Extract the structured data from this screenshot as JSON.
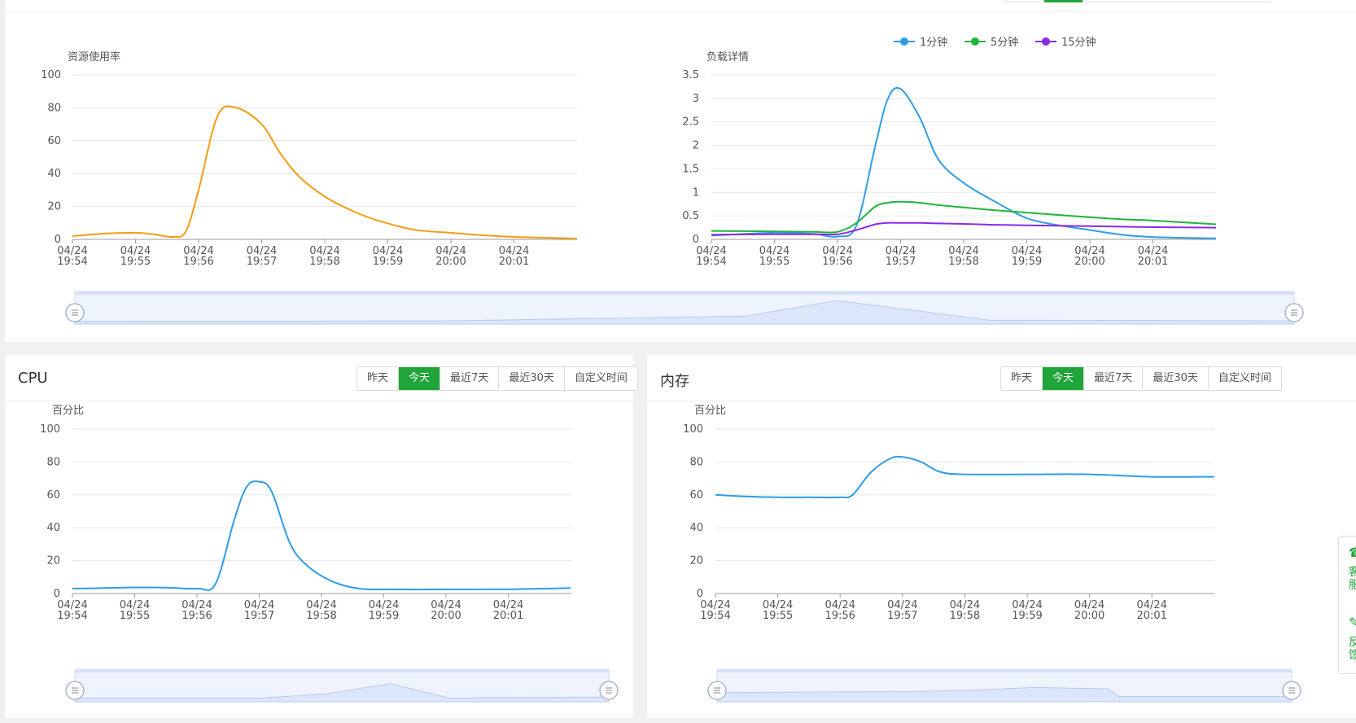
{
  "time_buttons": [
    "昨天",
    "今天",
    "最近7天",
    "最近30天",
    "自定义时间"
  ],
  "time_active_index": 1,
  "cpu_panel": {
    "title": "CPU"
  },
  "mem_panel": {
    "title": "内存"
  },
  "side_float": {
    "service_label": "客服",
    "feedback_label": "反馈"
  },
  "colors": {
    "accent": "#20a53a",
    "orange": "#f39c12",
    "blue": "#2f9ce9",
    "green": "#20b53a",
    "purple": "#8a2be2",
    "zoom_fill": "#dbe6fb"
  },
  "chart_data": [
    {
      "type": "line",
      "ylabel": "资源使用率",
      "ylim": [
        0,
        100
      ],
      "yticks": [
        0,
        20,
        40,
        60,
        80,
        100
      ],
      "xtick_labels": [
        [
          "04/24",
          "19:54"
        ],
        [
          "04/24",
          "19:55"
        ],
        [
          "04/24",
          "19:56"
        ],
        [
          "04/24",
          "19:57"
        ],
        [
          "04/24",
          "19:58"
        ],
        [
          "04/24",
          "19:59"
        ],
        [
          "04/24",
          "20:00"
        ],
        [
          "04/24",
          "20:01"
        ]
      ],
      "x": [
        0,
        0.5,
        1,
        1.3,
        1.6,
        1.8,
        2,
        2.3,
        2.6,
        3,
        3.3,
        3.6,
        4,
        4.4,
        4.8,
        5.4,
        6,
        6.5,
        7,
        7.5,
        8
      ],
      "series": [
        {
          "values": [
            2,
            3.5,
            4,
            3,
            1.5,
            5,
            30,
            75,
            80,
            70,
            52,
            38,
            26,
            18,
            12,
            6,
            4,
            2.5,
            1.5,
            1,
            0.5
          ],
          "color": "#f39c12"
        }
      ]
    },
    {
      "type": "line",
      "ylabel": "负载详情",
      "ylim": [
        0,
        3.5
      ],
      "yticks": [
        0,
        0.5,
        1,
        1.5,
        2,
        2.5,
        3,
        3.5
      ],
      "xtick_labels": [
        [
          "04/24",
          "19:54"
        ],
        [
          "04/24",
          "19:55"
        ],
        [
          "04/24",
          "19:56"
        ],
        [
          "04/24",
          "19:57"
        ],
        [
          "04/24",
          "19:58"
        ],
        [
          "04/24",
          "19:59"
        ],
        [
          "04/24",
          "20:00"
        ],
        [
          "04/24",
          "20:01"
        ]
      ],
      "x": [
        0,
        1,
        1.6,
        2,
        2.3,
        2.6,
        2.8,
        3,
        3.3,
        3.6,
        4,
        4.5,
        5,
        5.5,
        6,
        6.5,
        7,
        8
      ],
      "series": [
        {
          "name": "1分钟",
          "values": [
            0.08,
            0.14,
            0.12,
            0.06,
            0.3,
            2,
            3.0,
            3.2,
            2.6,
            1.7,
            1.2,
            0.8,
            0.45,
            0.3,
            0.2,
            0.1,
            0.05,
            0.02
          ],
          "color": "#2f9ce9"
        },
        {
          "name": "5分钟",
          "values": [
            0.18,
            0.17,
            0.16,
            0.16,
            0.35,
            0.7,
            0.78,
            0.8,
            0.78,
            0.73,
            0.68,
            0.62,
            0.57,
            0.52,
            0.47,
            0.43,
            0.4,
            0.32
          ],
          "color": "#20b53a"
        },
        {
          "name": "15分钟",
          "values": [
            0.1,
            0.11,
            0.11,
            0.11,
            0.2,
            0.32,
            0.35,
            0.35,
            0.35,
            0.34,
            0.33,
            0.31,
            0.3,
            0.29,
            0.28,
            0.27,
            0.26,
            0.25
          ],
          "color": "#8a2be2"
        }
      ],
      "legend": "top"
    },
    {
      "type": "line",
      "ylabel": "百分比",
      "ylim": [
        0,
        100
      ],
      "yticks": [
        0,
        20,
        40,
        60,
        80,
        100
      ],
      "xtick_labels": [
        [
          "04/24",
          "19:54"
        ],
        [
          "04/24",
          "19:55"
        ],
        [
          "04/24",
          "19:56"
        ],
        [
          "04/24",
          "19:57"
        ],
        [
          "04/24",
          "19:58"
        ],
        [
          "04/24",
          "19:59"
        ],
        [
          "04/24",
          "20:00"
        ],
        [
          "04/24",
          "20:01"
        ]
      ],
      "x": [
        0,
        0.5,
        1,
        1.5,
        2,
        2.3,
        2.6,
        2.8,
        3,
        3.2,
        3.5,
        3.8,
        4.2,
        4.6,
        5,
        6,
        7,
        8
      ],
      "series": [
        {
          "values": [
            3,
            3.3,
            3.7,
            3.6,
            3,
            6,
            45,
            65,
            68,
            62,
            30,
            16,
            7,
            3,
            2.5,
            2.5,
            2.6,
            3.3
          ],
          "color": "#2f9ce9"
        }
      ]
    },
    {
      "type": "line",
      "ylabel": "百分比",
      "ylim": [
        0,
        100
      ],
      "yticks": [
        0,
        20,
        40,
        60,
        80,
        100
      ],
      "xtick_labels": [
        [
          "04/24",
          "19:54"
        ],
        [
          "04/24",
          "19:55"
        ],
        [
          "04/24",
          "19:56"
        ],
        [
          "04/24",
          "19:57"
        ],
        [
          "04/24",
          "19:58"
        ],
        [
          "04/24",
          "19:59"
        ],
        [
          "04/24",
          "20:00"
        ],
        [
          "04/24",
          "20:01"
        ]
      ],
      "x": [
        0,
        0.5,
        1,
        1.5,
        2,
        2.2,
        2.5,
        2.8,
        3,
        3.3,
        3.6,
        4,
        5,
        6,
        7,
        8
      ],
      "series": [
        {
          "values": [
            60,
            59,
            58.5,
            58.5,
            58.5,
            60,
            74,
            82,
            83,
            80,
            74,
            72.5,
            72.5,
            72.5,
            71,
            71
          ],
          "color": "#2f9ce9"
        }
      ]
    }
  ]
}
